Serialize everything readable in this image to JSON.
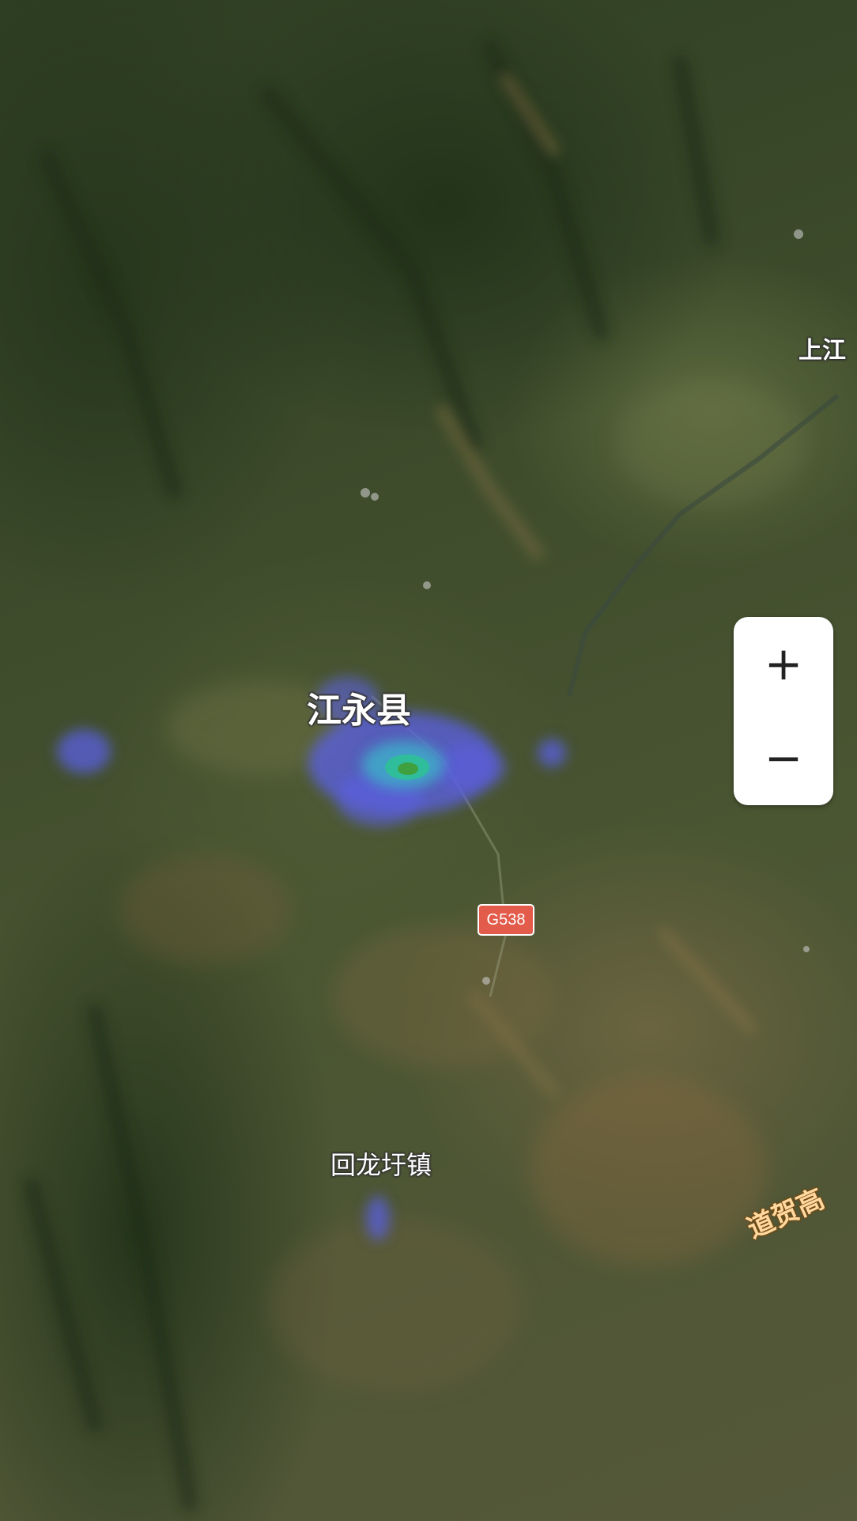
{
  "map": {
    "type": "satellite",
    "overlay": "heatmap"
  },
  "labels": {
    "county": "江永县",
    "town": "回龙圩镇",
    "upper_right": "上江",
    "highway": "道贺高",
    "road_shield": "G538"
  },
  "zoom": {
    "zoom_in": "+",
    "zoom_out": "−"
  },
  "heatmap": {
    "colors": [
      "#5a5fe0",
      "#3fa8c8",
      "#2fbf9a",
      "#3fa040"
    ],
    "hotspots": [
      "江永县",
      "回龙圩镇"
    ]
  }
}
